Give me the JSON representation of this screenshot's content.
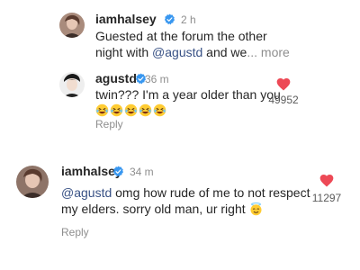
{
  "comments": [
    {
      "username": "iamhalsey",
      "time": "2 h",
      "line1": "Guested at the forum the other",
      "line2_prefix": "night with ",
      "line2_mention": "@agustd",
      "line2_suffix": " and we",
      "more": "... more"
    },
    {
      "username": "agustd",
      "time": "36 m",
      "line1": "twin??? I'm a year older than you",
      "emojis": [
        "laughing",
        "laughing",
        "laughing",
        "laughing",
        "laughing"
      ],
      "reply_label": "Reply",
      "like_count": "49952"
    },
    {
      "username": "iamhalsey",
      "time": "34 m",
      "line1_mention": "@agustd",
      "line1_suffix": " omg how rude of me to not respect",
      "line2": "my elders. sorry old man, ur right",
      "line2_emoji": "halo",
      "reply_label": "Reply",
      "like_count": "11297"
    }
  ],
  "colors": {
    "verified": "#3897f0",
    "heart": "#ed4956",
    "mention": "#385185",
    "muted": "#8e8e8e"
  }
}
